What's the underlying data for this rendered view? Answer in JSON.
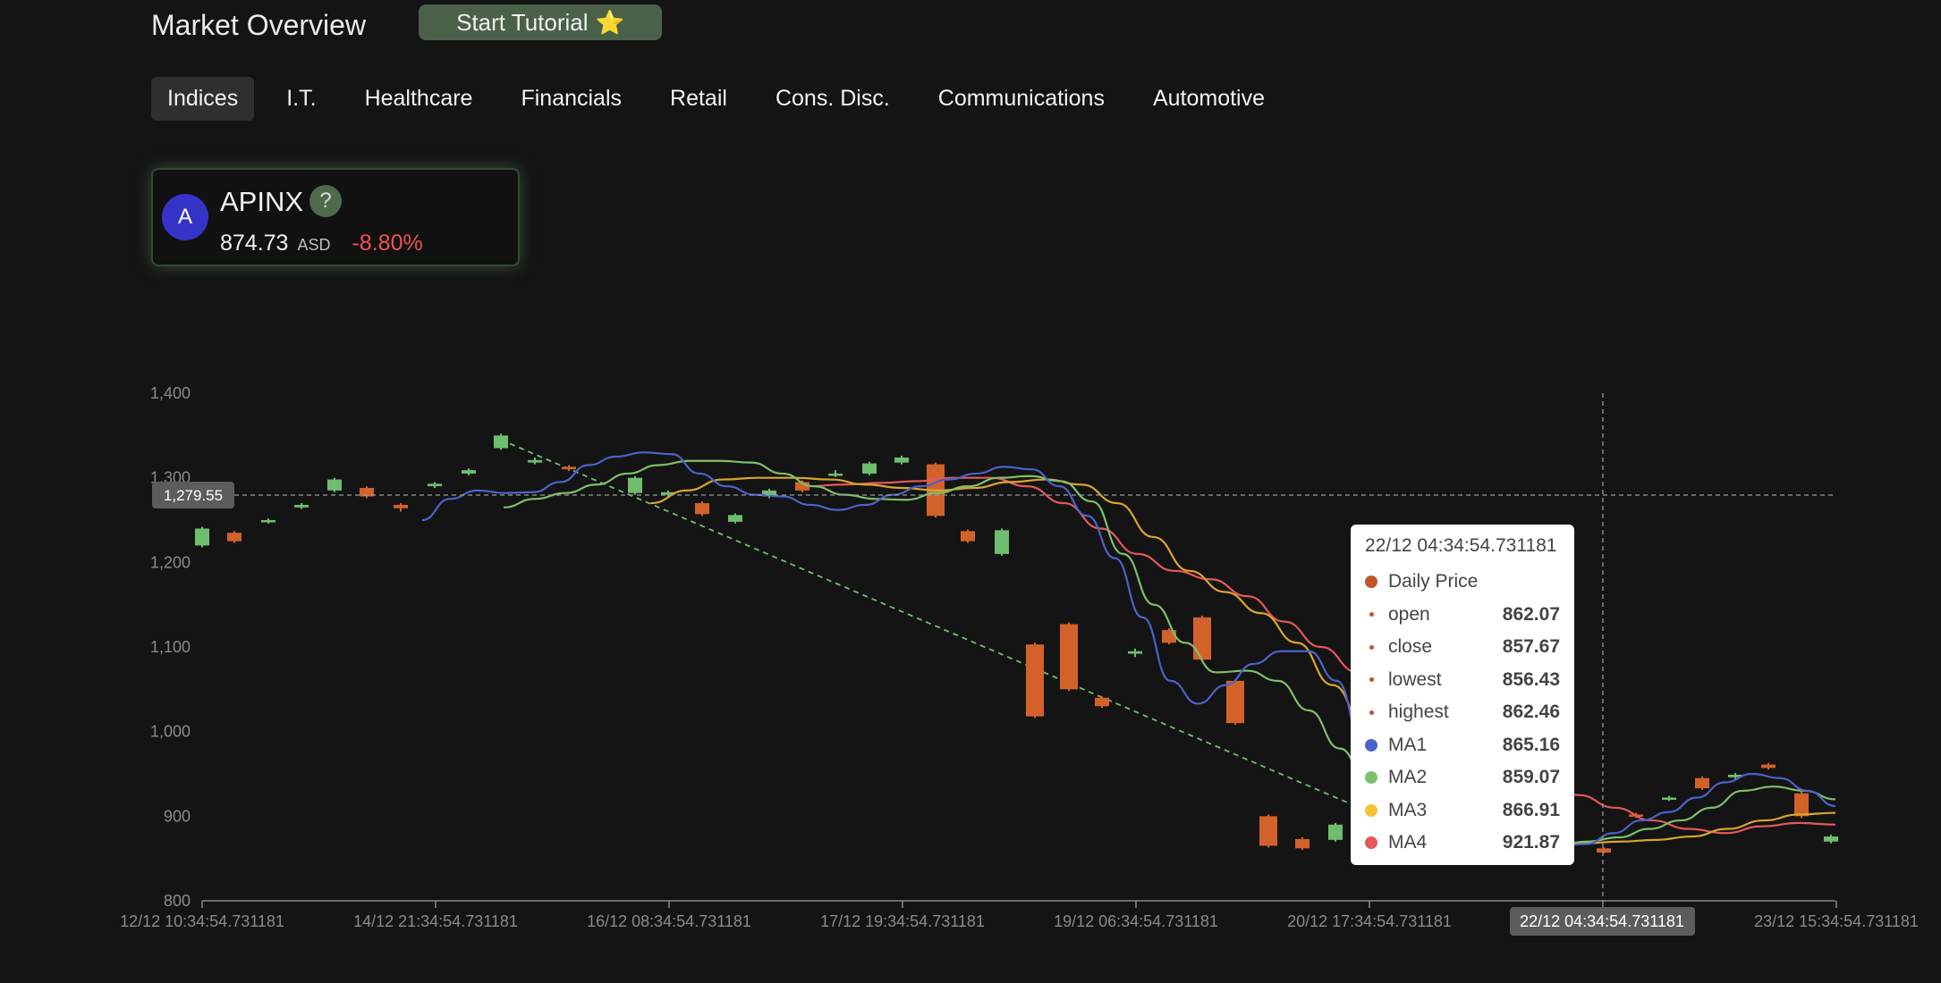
{
  "header": {
    "title": "Market Overview",
    "tutorial_label": "Start Tutorial",
    "tutorial_icon": "⭐"
  },
  "tabs": [
    {
      "label": "Indices",
      "active": true
    },
    {
      "label": "I.T."
    },
    {
      "label": "Healthcare"
    },
    {
      "label": "Financials"
    },
    {
      "label": "Retail"
    },
    {
      "label": "Cons. Disc."
    },
    {
      "label": "Communications"
    },
    {
      "label": "Automotive"
    }
  ],
  "ticker": {
    "avatar_letter": "A",
    "symbol": "APINX",
    "help_icon": "?",
    "price": "874.73",
    "currency": "ASD",
    "change": "-8.80%"
  },
  "colors": {
    "up": "#6fbd6f",
    "down": "#d2622a",
    "ma1": "#4a63c9",
    "ma2": "#7dc06a",
    "ma3": "#d9a62e",
    "ma4": "#e4585c",
    "trendline": "#6fbd6f"
  },
  "chart_data": {
    "type": "candlestick",
    "y_ticks": [
      "800",
      "900",
      "1,000",
      "1,100",
      "1,200",
      "1,300",
      "1,400"
    ],
    "ylim": [
      800,
      1400
    ],
    "x_ticks": [
      "12/12 10:34:54.731181",
      "14/12 21:34:54.731181",
      "16/12 08:34:54.731181",
      "17/12 19:34:54.731181",
      "19/12 06:34:54.731181",
      "20/12 17:34:54.731181",
      "22/12 04:34:54.731181",
      "23/12 15:34:54.731181"
    ],
    "crosshair": {
      "y_value": 1279.55,
      "y_label": "1,279.55",
      "x_index": 6,
      "x_label": "22/12 04:34:54.731181"
    },
    "candles": [
      {
        "o": 1220,
        "c": 1240,
        "h": 1242,
        "l": 1218
      },
      {
        "o": 1235,
        "c": 1225,
        "h": 1237,
        "l": 1223
      },
      {
        "o": 1248,
        "c": 1250,
        "h": 1252,
        "l": 1246
      },
      {
        "o": 1265,
        "c": 1268,
        "h": 1270,
        "l": 1263
      },
      {
        "o": 1285,
        "c": 1298,
        "h": 1300,
        "l": 1283
      },
      {
        "o": 1288,
        "c": 1278,
        "h": 1290,
        "l": 1276
      },
      {
        "o": 1268,
        "c": 1264,
        "h": 1270,
        "l": 1260
      },
      {
        "o": 1290,
        "c": 1293,
        "h": 1295,
        "l": 1288
      },
      {
        "o": 1305,
        "c": 1309,
        "h": 1311,
        "l": 1303
      },
      {
        "o": 1335,
        "c": 1350,
        "h": 1352,
        "l": 1333
      },
      {
        "o": 1318,
        "c": 1321,
        "h": 1324,
        "l": 1316
      },
      {
        "o": 1313,
        "c": 1310,
        "h": 1315,
        "l": 1308
      },
      {
        "o": 1282,
        "c": 1300,
        "h": 1302,
        "l": 1280
      },
      {
        "o": 1280,
        "c": 1283,
        "h": 1285,
        "l": 1278
      },
      {
        "o": 1270,
        "c": 1257,
        "h": 1272,
        "l": 1255
      },
      {
        "o": 1248,
        "c": 1256,
        "h": 1258,
        "l": 1246
      },
      {
        "o": 1278,
        "c": 1285,
        "h": 1287,
        "l": 1276
      },
      {
        "o": 1295,
        "c": 1285,
        "h": 1297,
        "l": 1283
      },
      {
        "o": 1303,
        "c": 1305,
        "h": 1309,
        "l": 1301
      },
      {
        "o": 1305,
        "c": 1317,
        "h": 1319,
        "l": 1303
      },
      {
        "o": 1318,
        "c": 1324,
        "h": 1326,
        "l": 1316
      },
      {
        "o": 1316,
        "c": 1255,
        "h": 1318,
        "l": 1253
      },
      {
        "o": 1237,
        "c": 1225,
        "h": 1239,
        "l": 1223
      },
      {
        "o": 1210,
        "c": 1238,
        "h": 1240,
        "l": 1208
      },
      {
        "o": 1103,
        "c": 1018,
        "h": 1105,
        "l": 1016
      },
      {
        "o": 1127,
        "c": 1050,
        "h": 1129,
        "l": 1048
      },
      {
        "o": 1040,
        "c": 1030,
        "h": 1042,
        "l": 1028
      },
      {
        "o": 1092,
        "c": 1095,
        "h": 1098,
        "l": 1088
      },
      {
        "o": 1120,
        "c": 1105,
        "h": 1122,
        "l": 1103
      },
      {
        "o": 1135,
        "c": 1085,
        "h": 1137,
        "l": 1083
      },
      {
        "o": 1060,
        "c": 1010,
        "h": 1062,
        "l": 1008
      },
      {
        "o": 900,
        "c": 865,
        "h": 902,
        "l": 863
      },
      {
        "o": 873,
        "c": 862,
        "h": 875,
        "l": 860
      },
      {
        "o": 872,
        "c": 890,
        "h": 892,
        "l": 870
      },
      {
        "o": 865,
        "c": 870,
        "h": 872,
        "l": 863
      },
      {
        "o": 848,
        "c": 852,
        "h": 855,
        "l": 845
      },
      {
        "o": 870,
        "c": 866,
        "h": 872,
        "l": 864
      },
      {
        "o": 862,
        "c": 857,
        "h": 863,
        "l": 856
      },
      {
        "o": 902,
        "c": 900,
        "h": 904,
        "l": 898
      },
      {
        "o": 920,
        "c": 922,
        "h": 924,
        "l": 918
      },
      {
        "o": 945,
        "c": 933,
        "h": 947,
        "l": 931
      },
      {
        "o": 946,
        "c": 949,
        "h": 951,
        "l": 944
      },
      {
        "o": 961,
        "c": 957,
        "h": 963,
        "l": 955
      },
      {
        "o": 927,
        "c": 900,
        "h": 929,
        "l": 898
      },
      {
        "o": 870,
        "c": 876,
        "h": 878,
        "l": 868
      }
    ],
    "ma1": [
      null,
      null,
      null,
      null,
      null,
      null,
      1250,
      1275,
      1285,
      1282,
      1283,
      1295,
      1315,
      1325,
      1330,
      1328,
      1305,
      1290,
      1280,
      1278,
      1268,
      1262,
      1268,
      1280,
      1290,
      1298,
      1305,
      1313,
      1310,
      1290,
      1255,
      1205,
      1135,
      1060,
      1033,
      1055,
      1080,
      1095,
      1095,
      1060,
      980,
      920,
      880,
      875,
      870,
      868,
      866,
      865,
      867,
      880,
      895,
      905,
      922,
      940,
      950,
      945,
      930,
      912
    ],
    "ma2": [
      null,
      null,
      null,
      null,
      null,
      null,
      null,
      null,
      1265,
      1275,
      1282,
      1292,
      1305,
      1315,
      1320,
      1320,
      1318,
      1305,
      1290,
      1280,
      1275,
      1274,
      1282,
      1290,
      1300,
      1302,
      1296,
      1272,
      1210,
      1150,
      1105,
      1070,
      1072,
      1060,
      1025,
      980,
      930,
      895,
      882,
      870,
      868,
      866,
      866,
      870,
      875,
      885,
      895,
      910,
      930,
      935,
      930,
      920
    ],
    "ma3": [
      null,
      null,
      null,
      null,
      null,
      null,
      null,
      null,
      null,
      null,
      null,
      1270,
      1285,
      1298,
      1300,
      1300,
      1298,
      1292,
      1288,
      1285,
      1288,
      1295,
      1298,
      1292,
      1270,
      1230,
      1190,
      1165,
      1140,
      1105,
      1055,
      995,
      960,
      930,
      905,
      880,
      870,
      868,
      870,
      872,
      876,
      885,
      895,
      902,
      904
    ],
    "ma4": [
      null,
      null,
      null,
      null,
      null,
      null,
      null,
      null,
      null,
      null,
      null,
      null,
      null,
      null,
      null,
      1290,
      1292,
      1294,
      1296,
      1300,
      1300,
      1290,
      1270,
      1240,
      1210,
      1190,
      1180,
      1160,
      1130,
      1100,
      1070,
      1040,
      1020,
      990,
      960,
      940,
      925,
      910,
      895,
      885,
      880,
      888,
      892,
      890
    ]
  },
  "tooltip": {
    "time": "22/12 04:34:54.731181",
    "series_name": "Daily Price",
    "rows": [
      {
        "label": "open",
        "value": "862.07"
      },
      {
        "label": "close",
        "value": "857.67"
      },
      {
        "label": "lowest",
        "value": "856.43"
      },
      {
        "label": "highest",
        "value": "862.46"
      }
    ],
    "ma_rows": [
      {
        "label": "MA1",
        "value": "865.16",
        "color": "#4a63c9"
      },
      {
        "label": "MA2",
        "value": "859.07",
        "color": "#7dc06a"
      },
      {
        "label": "MA3",
        "value": "866.91",
        "color": "#f5c23a"
      },
      {
        "label": "MA4",
        "value": "921.87",
        "color": "#e4585c"
      }
    ]
  }
}
